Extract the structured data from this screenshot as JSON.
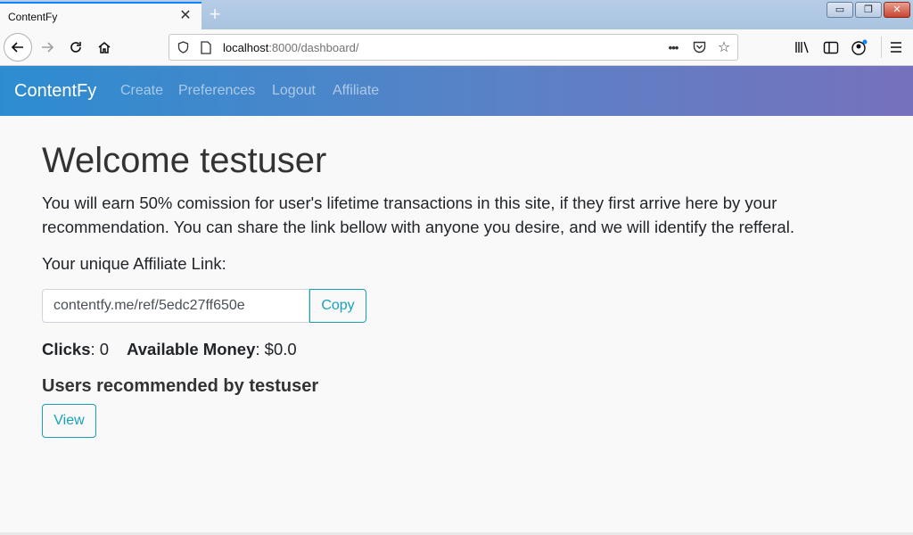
{
  "browser": {
    "tab_title": "ContentFy",
    "tab_close": "✕",
    "new_tab": "+",
    "url_host": "localhost",
    "url_rest": ":8000/dashboard/",
    "window_buttons": {
      "minimize": "▭",
      "restore": "❐",
      "close": "✕"
    }
  },
  "site_nav": {
    "brand": "ContentFy",
    "links": [
      "Create",
      "Preferences",
      "Logout",
      "Affiliate"
    ]
  },
  "main": {
    "welcome": "Welcome testuser",
    "lead_line1": "You will earn 50% comission for user's lifetime transactions in this site, if they first arrive here by your",
    "lead_line2": "recommendation. You can share the link bellow with anyone you desire, and we will identify the refferal.",
    "affiliate_label": "Your unique Affiliate Link:",
    "affiliate_link": "contentfy.me/ref/5edc27ff650e",
    "copy_label": "Copy",
    "clicks_label": "Clicks",
    "clicks_value": ": 0",
    "money_label": "Available Money",
    "money_value": ": $0.0",
    "recommended_title": "Users recommended by testuser",
    "view_label": "View"
  },
  "colors": {
    "nav_gradient_start": "#2d8cd0",
    "nav_gradient_end": "#7671bd",
    "accent": "#17a2b8",
    "tab_highlight": "#0a84ff"
  }
}
